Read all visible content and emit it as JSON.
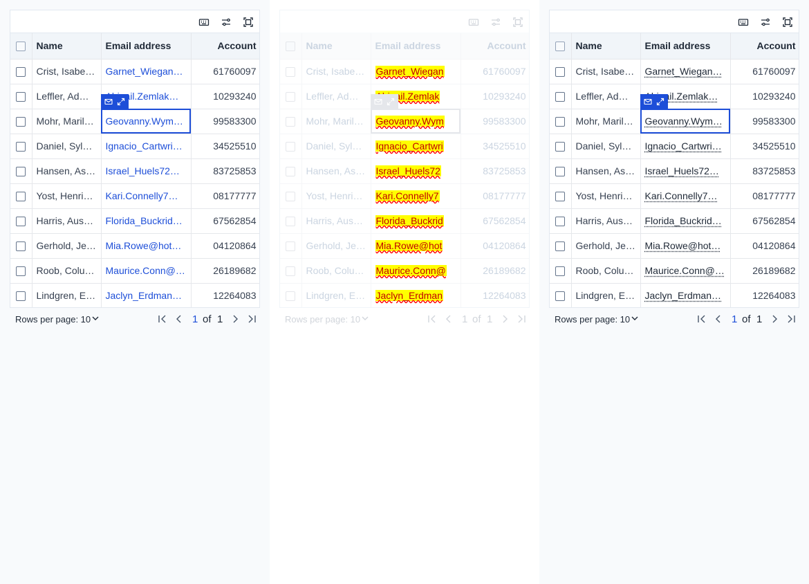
{
  "toolbar": {
    "icons": [
      "keyboard-icon",
      "filter-sliders-icon",
      "fullscreen-icon"
    ]
  },
  "columns": {
    "name": "Name",
    "email": "Email address",
    "account": "Account"
  },
  "rows": [
    {
      "name": "Crist, Isabe…",
      "email": "Garnet_Wiegan…",
      "account": "61760097"
    },
    {
      "name": "Leffler, Ad…",
      "email": "Abigail.Zemlak…",
      "account": "10293240"
    },
    {
      "name": "Mohr, Maril…",
      "email": "Geovanny.Wym…",
      "account": "99583300"
    },
    {
      "name": "Daniel, Syl…",
      "email": "Ignacio_Cartwri…",
      "account": "34525510"
    },
    {
      "name": "Hansen, As…",
      "email": "Israel_Huels72…",
      "account": "83725853"
    },
    {
      "name": "Yost, Henri…",
      "email": "Kari.Connelly7…",
      "account": "08177777"
    },
    {
      "name": "Harris, Aus…",
      "email": "Florida_Buckrid…",
      "account": "67562854"
    },
    {
      "name": "Gerhold, Je…",
      "email": "Mia.Rowe@hot…",
      "account": "04120864"
    },
    {
      "name": "Roob, Colu…",
      "email": "Maurice.Conn@…",
      "account": "26189682"
    },
    {
      "name": "Lindgren, E…",
      "email": "Jaclyn_Erdman…",
      "account": "12264083"
    }
  ],
  "faded_emails": [
    "Garnet_Wiegan",
    "Abigail.Zemlak",
    "Geovanny.Wym",
    "Ignacio_Cartwri",
    "Israel_Huels72",
    "Kari.Connelly7",
    "Florida_Buckrid",
    "Mia.Rowe@hot",
    "Maurice.Conn@",
    "Jaclyn_Erdman"
  ],
  "selected_row_index": 2,
  "footer": {
    "rows_per_page_label": "Rows per page: 10",
    "current_page": "1",
    "of_label": "of",
    "total_pages": "1"
  },
  "colors": {
    "accent": "#1d4ed8",
    "header_bg": "#f1f5f9",
    "spell_highlight": "#ffff00",
    "spell_text": "#c00000"
  }
}
